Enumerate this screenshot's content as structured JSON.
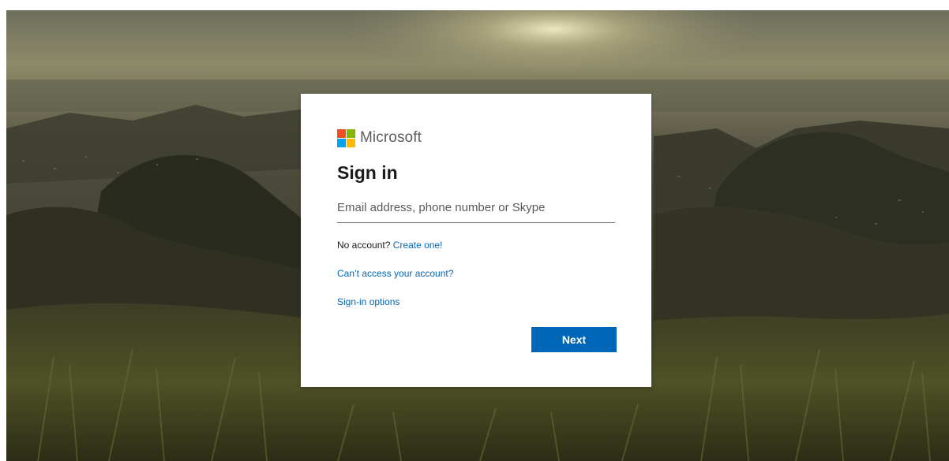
{
  "brand": {
    "name": "Microsoft",
    "logo_colors": [
      "#f25022",
      "#7fba00",
      "#00a4ef",
      "#ffb900"
    ]
  },
  "signin": {
    "title": "Sign in",
    "email_placeholder": "Email address, phone number or Skype",
    "email_value": "",
    "no_account_text": "No account?",
    "create_link": "Create one!",
    "cant_access_link": "Can’t access your account?",
    "options_link": "Sign-in options",
    "next_label": "Next"
  },
  "colors": {
    "accent": "#0067b8",
    "title_text": "#1b1b1b",
    "card_bg": "#ffffff"
  }
}
